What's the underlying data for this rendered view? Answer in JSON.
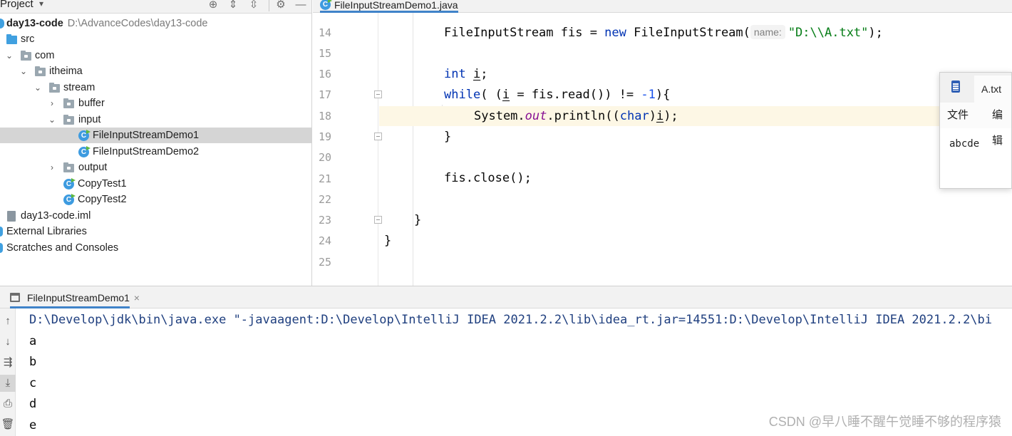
{
  "project": {
    "title": "Project",
    "tree": [
      {
        "label": "day13-code",
        "path": "D:\\AdvanceCodes\\day13-code",
        "bold": true,
        "depth": 0,
        "arrow": "",
        "icon": "module-dot-icon"
      },
      {
        "label": "src",
        "depth": 0,
        "arrow": "",
        "icon": "source-folder-icon"
      },
      {
        "label": "com",
        "depth": 0,
        "arrow": "expanded",
        "icon": "package-icon"
      },
      {
        "label": "itheima",
        "depth": 1,
        "arrow": "expanded",
        "icon": "package-icon"
      },
      {
        "label": "stream",
        "depth": 2,
        "arrow": "expanded",
        "icon": "package-icon"
      },
      {
        "label": "buffer",
        "depth": 3,
        "arrow": "collapsed",
        "icon": "package-icon"
      },
      {
        "label": "input",
        "depth": 3,
        "arrow": "expanded",
        "icon": "package-icon"
      },
      {
        "label": "FileInputStreamDemo1",
        "depth": 4,
        "arrow": "",
        "icon": "java-class-icon",
        "selected": true
      },
      {
        "label": "FileInputStreamDemo2",
        "depth": 4,
        "arrow": "",
        "icon": "java-class-icon"
      },
      {
        "label": "output",
        "depth": 3,
        "arrow": "collapsed",
        "icon": "package-icon"
      },
      {
        "label": "CopyTest1",
        "depth": 3,
        "arrow": "",
        "icon": "java-class-icon"
      },
      {
        "label": "CopyTest2",
        "depth": 3,
        "arrow": "",
        "icon": "java-class-icon"
      },
      {
        "label": "day13-code.iml",
        "depth": 0,
        "arrow": "",
        "icon": "iml-file-icon"
      },
      {
        "label": "External Libraries",
        "depth": 0,
        "arrow": "",
        "icon": "library-icon"
      },
      {
        "label": "Scratches and Consoles",
        "depth": 0,
        "arrow": "",
        "icon": "scratches-icon"
      }
    ]
  },
  "editor": {
    "tab_label": "FileInputStreamDemo1.java",
    "line_numbers": [
      "14",
      "15",
      "16",
      "17",
      "18",
      "19",
      "20",
      "21",
      "22",
      "23",
      "24",
      "25"
    ],
    "param_hint": "name:",
    "lines": {
      "l14_a": "FileInputStream fis = ",
      "l14_kw": "new",
      "l14_b": " FileInputStream(",
      "l14_str": "\"D:\\\\A.txt\"",
      "l14_c": ");",
      "l16_kw": "int",
      "l16_var": "i",
      "l16_end": ";",
      "l17_kw": "while",
      "l17_a": "( (",
      "l17_var": "i",
      "l17_b": " = fis.read()) != ",
      "l17_num": "-1",
      "l17_c": "){",
      "l18_a": "System.",
      "l18_out": "out",
      "l18_b": ".println((",
      "l18_kw": "char",
      "l18_c": ")",
      "l18_var": "i",
      "l18_d": ");",
      "l19": "}",
      "l21": "fis.close();",
      "l23": "}",
      "l24": "}"
    }
  },
  "notepad": {
    "tab_label": "A.txt",
    "menu_file": "文件",
    "menu_edit": "编辑",
    "content": "abcde"
  },
  "run": {
    "tab_label": "FileInputStreamDemo1",
    "console": [
      "D:\\Develop\\jdk\\bin\\java.exe \"-javaagent:D:\\Develop\\IntelliJ IDEA 2021.2.2\\lib\\idea_rt.jar=14551:D:\\Develop\\IntelliJ IDEA 2021.2.2\\bi",
      "a",
      "b",
      "c",
      "d",
      "e"
    ]
  },
  "watermark": "CSDN @早八睡不醒午觉睡不够的程序猿",
  "colors": {
    "keyword": "#0033b3",
    "string": "#067d17",
    "number": "#1750eb",
    "static_field": "#871094",
    "selection": "#d5d5d5",
    "caret_line": "#fdf7e5",
    "tab_underline": "#4083c9"
  }
}
